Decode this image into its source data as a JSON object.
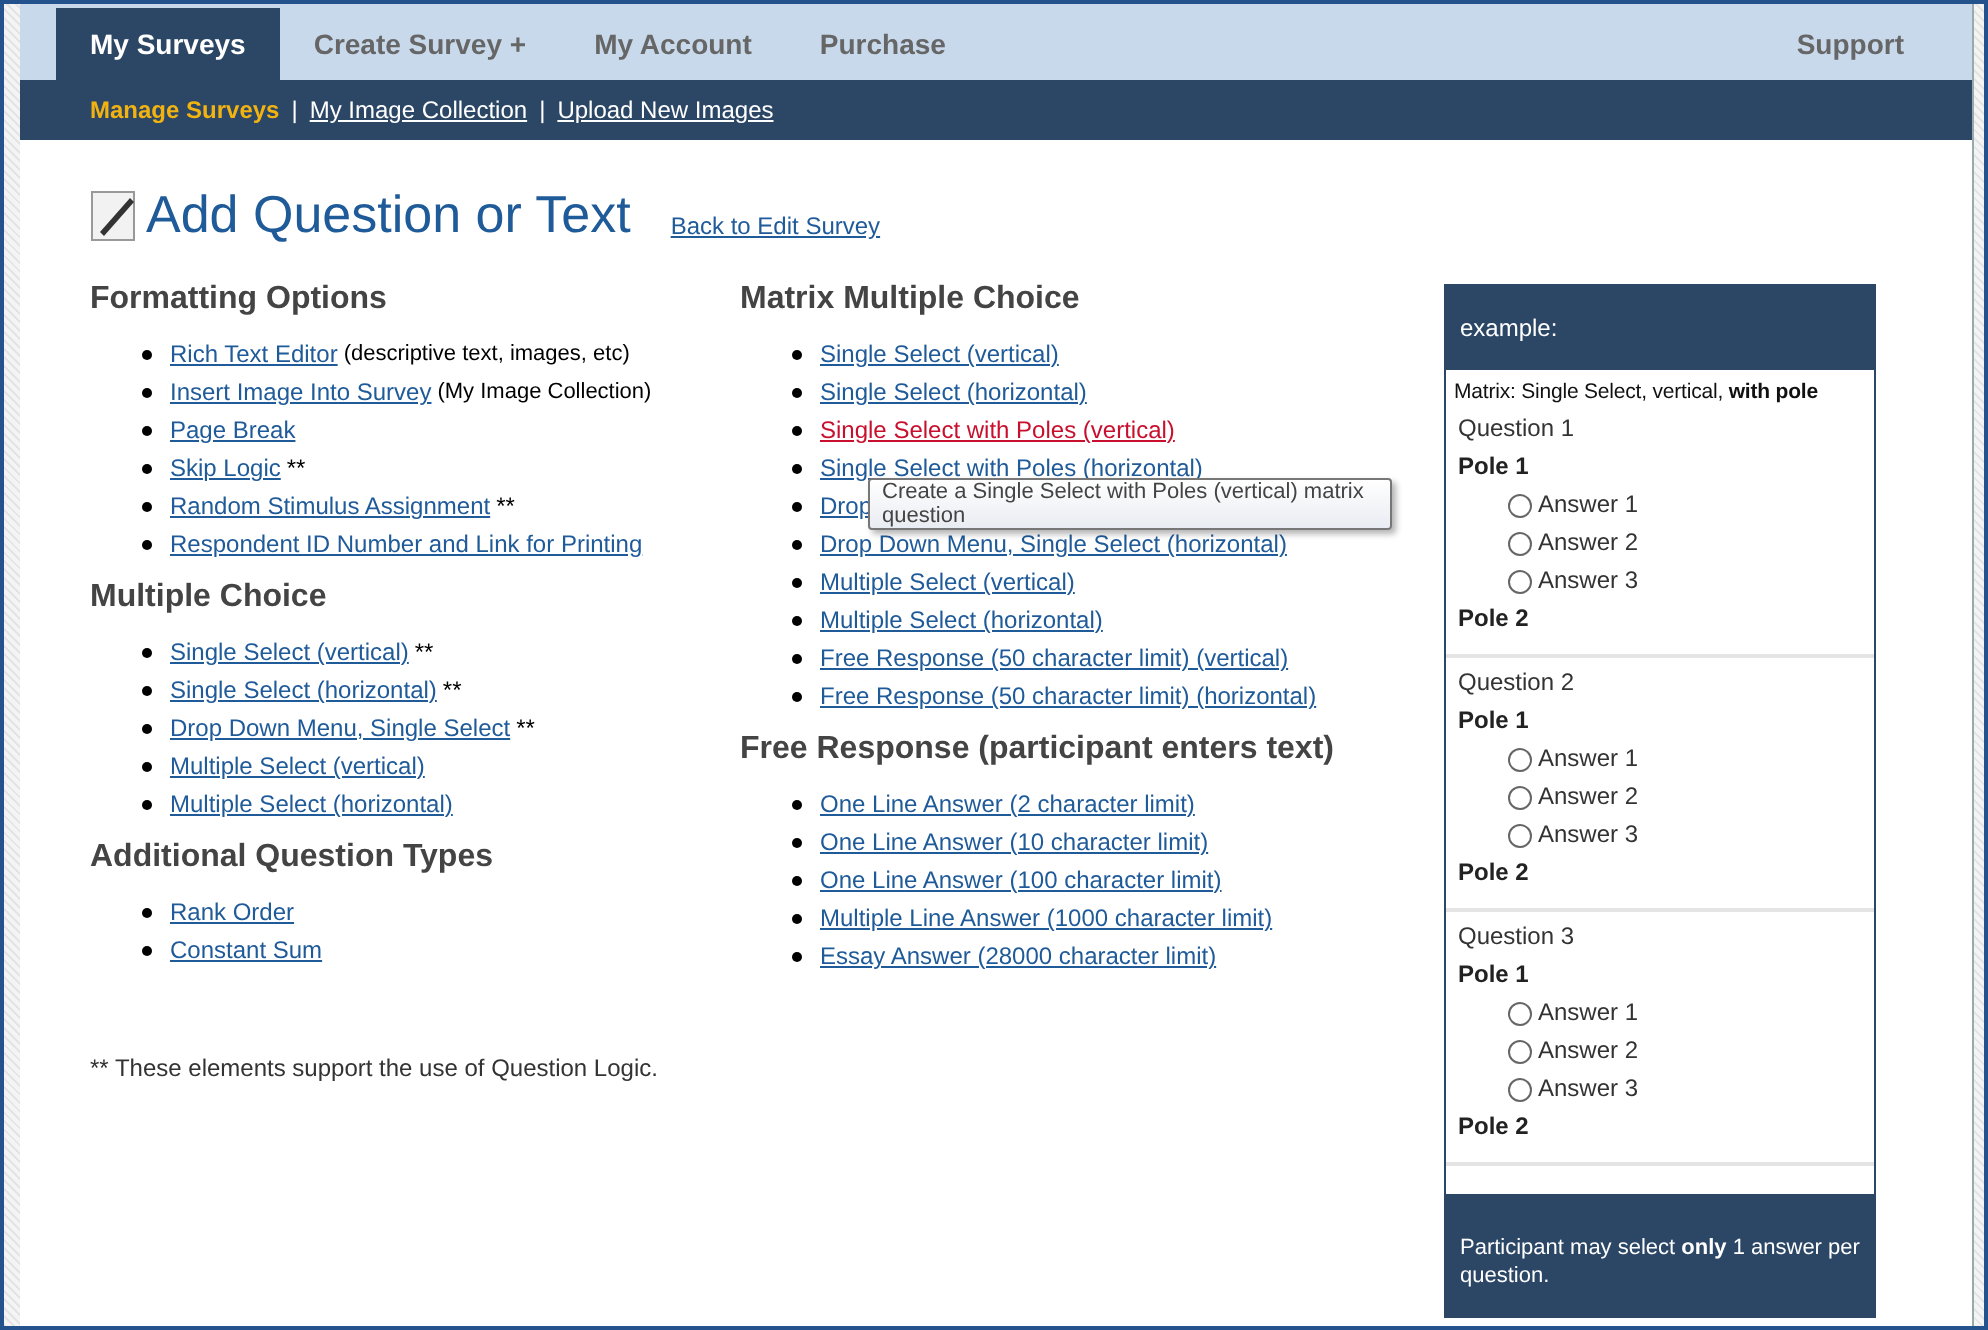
{
  "nav": {
    "tabs": [
      {
        "label": "My Surveys",
        "selected": true
      },
      {
        "label": "Create Survey +",
        "selected": false
      },
      {
        "label": "My Account",
        "selected": false
      },
      {
        "label": "Purchase",
        "selected": false
      }
    ],
    "support": "Support"
  },
  "subnav_separator": "|",
  "subnav": [
    {
      "label": "Manage Surveys",
      "selected": true
    },
    {
      "label": "My Image Collection",
      "selected": false
    },
    {
      "label": "Upload New Images",
      "selected": false
    }
  ],
  "page": {
    "title": "Add Question or Text",
    "back_link": "Back to Edit Survey"
  },
  "left_sections": [
    {
      "heading": "Formatting Options",
      "items": [
        {
          "link": "Rich Text Editor",
          "note": "(descriptive text, images, etc)"
        },
        {
          "link": "Insert Image Into Survey",
          "note": "(My Image Collection)"
        },
        {
          "link": "Page Break"
        },
        {
          "link": "Skip Logic",
          "note": "**"
        },
        {
          "link": "Random Stimulus Assignment",
          "note": "**"
        },
        {
          "link": "Respondent ID Number and Link for Printing"
        }
      ]
    },
    {
      "heading": "Multiple Choice",
      "items": [
        {
          "link": "Single Select (vertical)",
          "note": "**"
        },
        {
          "link": "Single Select (horizontal)",
          "note": "**"
        },
        {
          "link": "Drop Down Menu, Single Select",
          "note": "**"
        },
        {
          "link": "Multiple Select (vertical)"
        },
        {
          "link": "Multiple Select (horizontal)"
        }
      ]
    },
    {
      "heading": "Additional Question Types",
      "items": [
        {
          "link": "Rank Order"
        },
        {
          "link": "Constant Sum"
        }
      ]
    }
  ],
  "footnote": "** These elements support the use of Question Logic.",
  "middle_sections": [
    {
      "heading": "Matrix Multiple Choice",
      "items": [
        {
          "link": "Single Select (vertical)",
          "hovered": false
        },
        {
          "link": "Single Select (horizontal)",
          "hovered": false
        },
        {
          "link": "Single Select with Poles (vertical)",
          "hovered": true
        },
        {
          "link": "Single Select with Poles (horizontal)",
          "hovered": false
        },
        {
          "link": "Drop",
          "hovered": false
        },
        {
          "link": "Drop Down Menu, Single Select (horizontal)",
          "hovered": false
        },
        {
          "link": "Multiple Select (vertical)",
          "hovered": false
        },
        {
          "link": "Multiple Select (horizontal)",
          "hovered": false
        },
        {
          "link": "Free Response (50 character limit) (vertical)",
          "hovered": false
        },
        {
          "link": "Free Response (50 character limit) (horizontal)",
          "hovered": false
        }
      ]
    },
    {
      "heading": "Free Response (participant enters text)",
      "items": [
        {
          "link": "One Line Answer (2 character limit)",
          "hovered": false
        },
        {
          "link": "One Line Answer (10 character limit)",
          "hovered": false
        },
        {
          "link": "One Line Answer (100 character limit)",
          "hovered": false
        },
        {
          "link": "Multiple Line Answer (1000 character limit)",
          "hovered": false
        },
        {
          "link": "Essay Answer (28000 character limit)",
          "hovered": false
        }
      ]
    }
  ],
  "tooltip": "Create a Single Select with Poles (vertical) matrix question",
  "example": {
    "header": "example:",
    "description": "Matrix: Single Select, vertical, **with pole**",
    "questions": [
      {
        "title": "Question 1",
        "pole_1": "Pole 1",
        "answers": [
          {
            "label": "Answer 1",
            "selected": false
          },
          {
            "label": "Answer 2",
            "selected": false
          },
          {
            "label": "Answer 3",
            "selected": false
          }
        ],
        "pole_2": "Pole 2"
      },
      {
        "title": "Question 2",
        "pole_1": "Pole 1",
        "answers": [
          {
            "label": "Answer 1",
            "selected": false
          },
          {
            "label": "Answer 2",
            "selected": false
          },
          {
            "label": "Answer 3",
            "selected": false
          }
        ],
        "pole_2": "Pole 2"
      },
      {
        "title": "Question 3",
        "pole_1": "Pole 1",
        "answers": [
          {
            "label": "Answer 1",
            "selected": false
          },
          {
            "label": "Answer 2",
            "selected": false
          },
          {
            "label": "Answer 3",
            "selected": false
          }
        ],
        "pole_2": "Pole 2"
      }
    ],
    "footer": "Participant may select **only** 1 answer per question."
  }
}
